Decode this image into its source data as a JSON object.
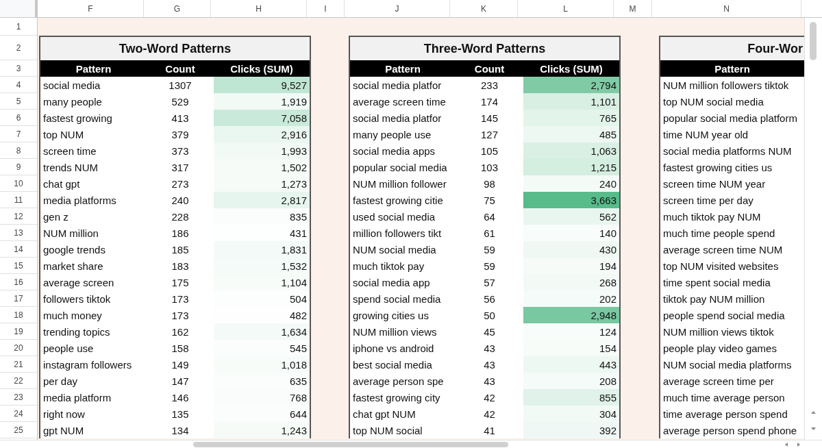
{
  "column_letters": [
    "F",
    "G",
    "H",
    "I",
    "J",
    "K",
    "L",
    "M",
    "N"
  ],
  "row_numbers": [
    "1",
    "2",
    "3",
    "4",
    "5",
    "6",
    "7",
    "8",
    "9",
    "10",
    "11",
    "12",
    "13",
    "14",
    "15",
    "16",
    "17",
    "18",
    "19",
    "20",
    "21",
    "22",
    "23",
    "24",
    "25"
  ],
  "tables": [
    {
      "title": "Two-Word Patterns",
      "columns": [
        "Pattern",
        "Count",
        "Clicks (SUM)"
      ],
      "rows": [
        {
          "pattern": "social media",
          "count": "1307",
          "clicks": "9,527",
          "color": "#bfe6d3"
        },
        {
          "pattern": "many people",
          "count": "529",
          "clicks": "1,919",
          "color": "#f2faf6"
        },
        {
          "pattern": "fastest growing",
          "count": "413",
          "clicks": "7,058",
          "color": "#c9eadb"
        },
        {
          "pattern": "top NUM",
          "count": "379",
          "clicks": "2,916",
          "color": "#eaf6f0"
        },
        {
          "pattern": "screen time",
          "count": "373",
          "clicks": "1,993",
          "color": "#f2faf6"
        },
        {
          "pattern": "trends NUM",
          "count": "317",
          "clicks": "1,502",
          "color": "#f6fbf8"
        },
        {
          "pattern": "chat gpt",
          "count": "273",
          "clicks": "1,273",
          "color": "#f6fbf8"
        },
        {
          "pattern": "media platforms",
          "count": "240",
          "clicks": "2,817",
          "color": "#e6f5ee"
        },
        {
          "pattern": "gen z",
          "count": "228",
          "clicks": "835",
          "color": "#fbfdfc"
        },
        {
          "pattern": "NUM million",
          "count": "186",
          "clicks": "431",
          "color": "#fdfefe"
        },
        {
          "pattern": "google trends",
          "count": "185",
          "clicks": "1,831",
          "color": "#f4faf7"
        },
        {
          "pattern": "market share",
          "count": "183",
          "clicks": "1,532",
          "color": "#f5fbf8"
        },
        {
          "pattern": "average screen",
          "count": "175",
          "clicks": "1,104",
          "color": "#f7fcf9"
        },
        {
          "pattern": "followers tiktok",
          "count": "173",
          "clicks": "504",
          "color": "#fcfefd"
        },
        {
          "pattern": "much money",
          "count": "173",
          "clicks": "482",
          "color": "#fdfefd"
        },
        {
          "pattern": "trending topics",
          "count": "162",
          "clicks": "1,634",
          "color": "#f4faf7"
        },
        {
          "pattern": "people use",
          "count": "158",
          "clicks": "545",
          "color": "#fbfdfc"
        },
        {
          "pattern": "instagram followers",
          "count": "149",
          "clicks": "1,018",
          "color": "#f7fcf9"
        },
        {
          "pattern": "per day",
          "count": "147",
          "clicks": "635",
          "color": "#fafdfb"
        },
        {
          "pattern": "media platform",
          "count": "146",
          "clicks": "768",
          "color": "#f9fcfa"
        },
        {
          "pattern": "right now",
          "count": "135",
          "clicks": "644",
          "color": "#fafdfb"
        },
        {
          "pattern": "gpt NUM",
          "count": "134",
          "clicks": "1,243",
          "color": "#f6fbf8"
        }
      ]
    },
    {
      "title": "Three-Word Patterns",
      "columns": [
        "Pattern",
        "Count",
        "Clicks (SUM)"
      ],
      "rows": [
        {
          "pattern": "social media platfor",
          "count": "233",
          "clicks": "2,794",
          "color": "#80cba6"
        },
        {
          "pattern": "average screen time",
          "count": "174",
          "clicks": "1,101",
          "color": "#d9efe4"
        },
        {
          "pattern": "social media platfor",
          "count": "145",
          "clicks": "765",
          "color": "#e3f4eb"
        },
        {
          "pattern": "many people use",
          "count": "127",
          "clicks": "485",
          "color": "#eef8f3"
        },
        {
          "pattern": "social media apps",
          "count": "105",
          "clicks": "1,063",
          "color": "#daf0e5"
        },
        {
          "pattern": "popular social media",
          "count": "103",
          "clicks": "1,215",
          "color": "#d4eee0"
        },
        {
          "pattern": "NUM million follower",
          "count": "98",
          "clicks": "240",
          "color": "#f4fbf7"
        },
        {
          "pattern": "fastest growing citie",
          "count": "75",
          "clicks": "3,663",
          "color": "#57bb8a"
        },
        {
          "pattern": "used social media",
          "count": "64",
          "clicks": "562",
          "color": "#e9f6ef"
        },
        {
          "pattern": "million followers tikt",
          "count": "61",
          "clicks": "140",
          "color": "#f8fcfa"
        },
        {
          "pattern": "NUM social media",
          "count": "59",
          "clicks": "430",
          "color": "#eff8f3"
        },
        {
          "pattern": "much tiktok pay",
          "count": "59",
          "clicks": "194",
          "color": "#f6fbf8"
        },
        {
          "pattern": "social media app",
          "count": "57",
          "clicks": "268",
          "color": "#f3faf6"
        },
        {
          "pattern": "spend social media",
          "count": "56",
          "clicks": "202",
          "color": "#f5fbf8"
        },
        {
          "pattern": "growing cities us",
          "count": "50",
          "clicks": "2,948",
          "color": "#78c8a1"
        },
        {
          "pattern": "NUM million views",
          "count": "45",
          "clicks": "124",
          "color": "#f8fcfa"
        },
        {
          "pattern": "iphone vs android",
          "count": "43",
          "clicks": "154",
          "color": "#f7fcf9"
        },
        {
          "pattern": "best social media",
          "count": "43",
          "clicks": "443",
          "color": "#eef8f3"
        },
        {
          "pattern": "average person spe",
          "count": "43",
          "clicks": "208",
          "color": "#f5fbf8"
        },
        {
          "pattern": "fastest growing city",
          "count": "42",
          "clicks": "855",
          "color": "#e0f2e9"
        },
        {
          "pattern": "chat gpt NUM",
          "count": "42",
          "clicks": "304",
          "color": "#f2faf6"
        },
        {
          "pattern": "top NUM social",
          "count": "41",
          "clicks": "392",
          "color": "#eff8f4"
        }
      ]
    },
    {
      "title": "Four-Wor",
      "columns": [
        "Pattern"
      ],
      "rows": [
        {
          "pattern": "NUM million followers tiktok"
        },
        {
          "pattern": "top NUM social media"
        },
        {
          "pattern": "popular social media platform"
        },
        {
          "pattern": "time NUM year old"
        },
        {
          "pattern": "social media platforms NUM"
        },
        {
          "pattern": "fastest growing cities us"
        },
        {
          "pattern": "screen time NUM year"
        },
        {
          "pattern": "screen time per day"
        },
        {
          "pattern": "much tiktok pay NUM"
        },
        {
          "pattern": "much time people spend"
        },
        {
          "pattern": "average screen time NUM"
        },
        {
          "pattern": "top NUM visited websites"
        },
        {
          "pattern": "time spent social media"
        },
        {
          "pattern": "tiktok pay NUM million"
        },
        {
          "pattern": "people spend social media"
        },
        {
          "pattern": "NUM million views tiktok"
        },
        {
          "pattern": "people play video games"
        },
        {
          "pattern": "NUM social media platforms"
        },
        {
          "pattern": "average screen time per"
        },
        {
          "pattern": "much time average person"
        },
        {
          "pattern": "time average person spend"
        },
        {
          "pattern": "average person spend phone"
        }
      ]
    }
  ]
}
